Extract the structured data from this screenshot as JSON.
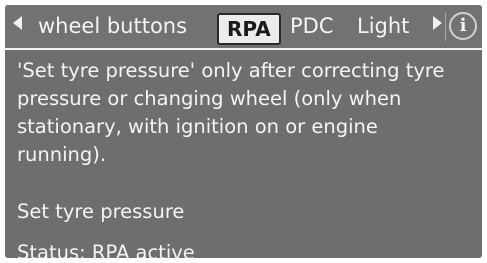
{
  "tabs": {
    "items": [
      {
        "label": "wheel buttons"
      },
      {
        "label": "RPA",
        "selected": true
      },
      {
        "label": "PDC"
      },
      {
        "label": "Light"
      }
    ],
    "prev_icon": "left-arrow-icon",
    "next_icon": "right-arrow-icon",
    "info_icon": "info-icon",
    "info_glyph": "i"
  },
  "content": {
    "description": "'Set tyre pressure' only after correcting tyre pressure or changing wheel (only when stationary, with ignition on or engine running).",
    "setting_label": "Set tyre pressure",
    "status_text": "Status: RPA active"
  },
  "colors": {
    "background": "#6e6e6c",
    "text": "#f4f4f4",
    "selected_tab_bg": "#ececec",
    "selected_tab_text": "#1a1a1a"
  }
}
